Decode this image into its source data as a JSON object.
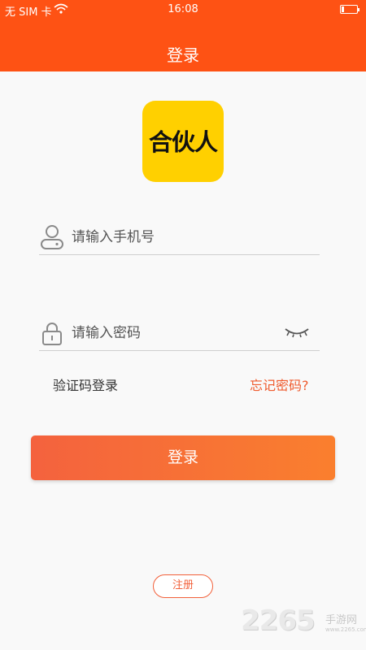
{
  "status_bar": {
    "carrier": "无 SIM 卡",
    "time": "16:08",
    "battery_level": 0.15
  },
  "title_bar": {
    "title": "登录"
  },
  "logo": {
    "text": "合伙人",
    "background": "#ffd000"
  },
  "form": {
    "phone_placeholder": "请输入手机号",
    "password_placeholder": "请输入密码",
    "sms_login_label": "验证码登录",
    "forgot_password_label": "忘记密码?",
    "login_label": "登录",
    "register_label": "注册"
  },
  "watermark": {
    "number": "2265",
    "label": "手游网",
    "url": "www.2265.com"
  },
  "colors": {
    "brand": "#fe5214",
    "accent_link": "#ef5b2e",
    "button_gradient_start": "#f4623e",
    "button_gradient_end": "#fa7f2e"
  },
  "icons": {
    "phone_field": "user-icon",
    "password_field": "lock-icon",
    "password_toggle": "eye-closed-icon"
  }
}
